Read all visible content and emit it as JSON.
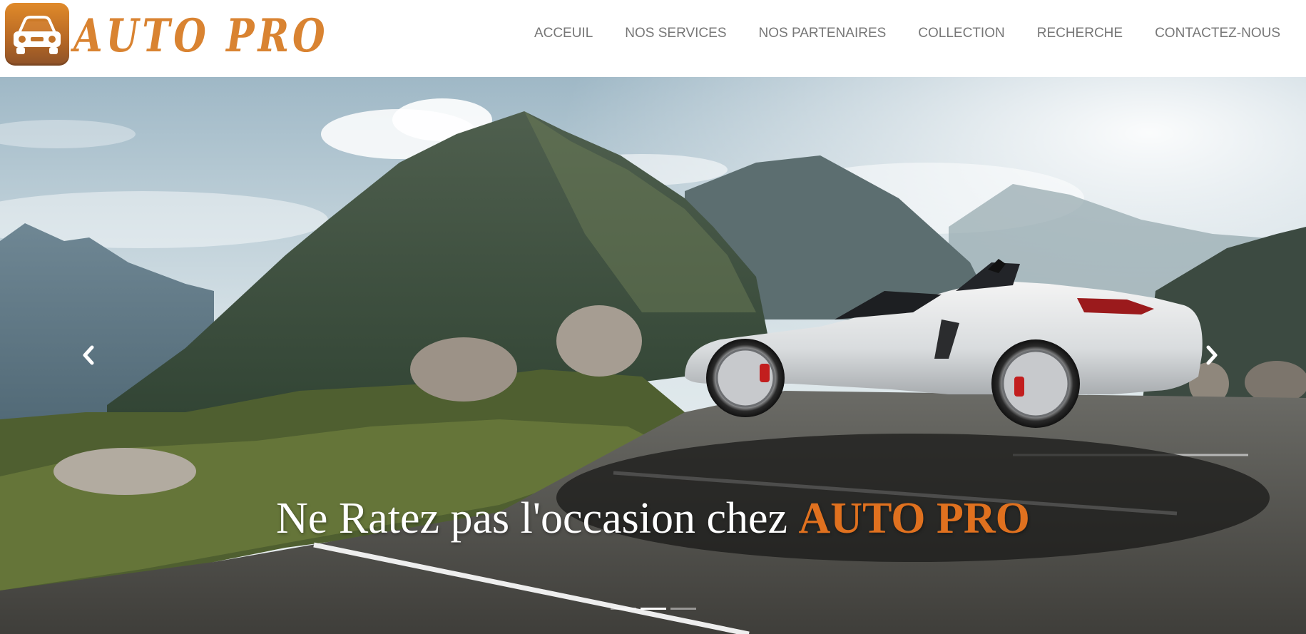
{
  "brand": {
    "name": "AUTO PRO",
    "logo_icon": "car-front-icon",
    "colors": {
      "primary": "#d98331",
      "logo_bg": "#c87a2a"
    }
  },
  "nav": {
    "items": [
      {
        "label": "ACCEUIL"
      },
      {
        "label": "NOS SERVICES"
      },
      {
        "label": "NOS PARTENAIRES"
      },
      {
        "label": "COLLECTION"
      },
      {
        "label": "RECHERCHE"
      },
      {
        "label": "CONTACTEZ-NOUS"
      }
    ]
  },
  "hero": {
    "caption_prefix": "Ne Ratez pas l'occasion chez",
    "caption_accent": "AUTO PRO",
    "accent_color": "#e0711f",
    "controls": {
      "prev_icon": "chevron-left-icon",
      "next_icon": "chevron-right-icon"
    },
    "slides_total": 3,
    "active_slide": 1
  }
}
